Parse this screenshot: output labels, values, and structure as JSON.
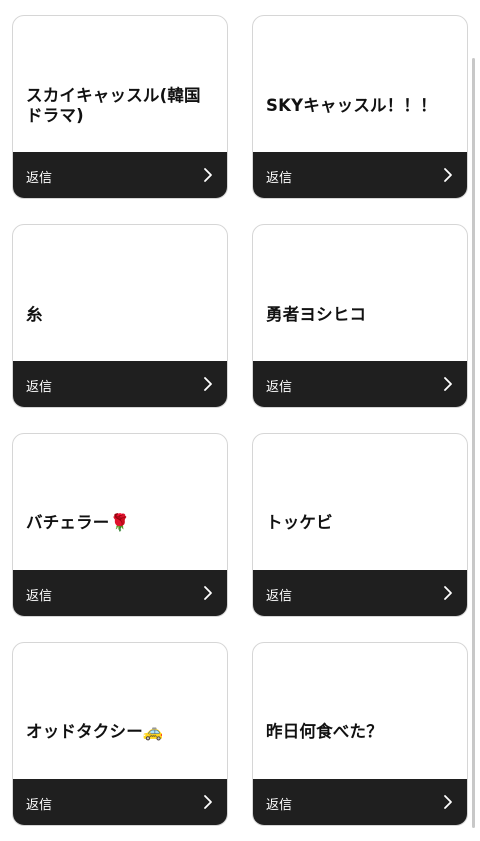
{
  "cards": [
    {
      "title": "スカイキャッスル(韓国ドラマ)",
      "reply": "返信"
    },
    {
      "title": "SKYキャッスル！！！",
      "reply": "返信"
    },
    {
      "title": "糸",
      "reply": "返信"
    },
    {
      "title": "勇者ヨシヒコ",
      "reply": "返信"
    },
    {
      "title": "バチェラー🌹",
      "reply": "返信"
    },
    {
      "title": "トッケビ",
      "reply": "返信"
    },
    {
      "title": "オッドタクシー🚕",
      "reply": "返信"
    },
    {
      "title": "昨日何食べた？",
      "reply": "返信"
    }
  ],
  "colors": {
    "footer": "#1f1f1f",
    "footer_text": "#ffffff",
    "title_text": "#111111"
  }
}
